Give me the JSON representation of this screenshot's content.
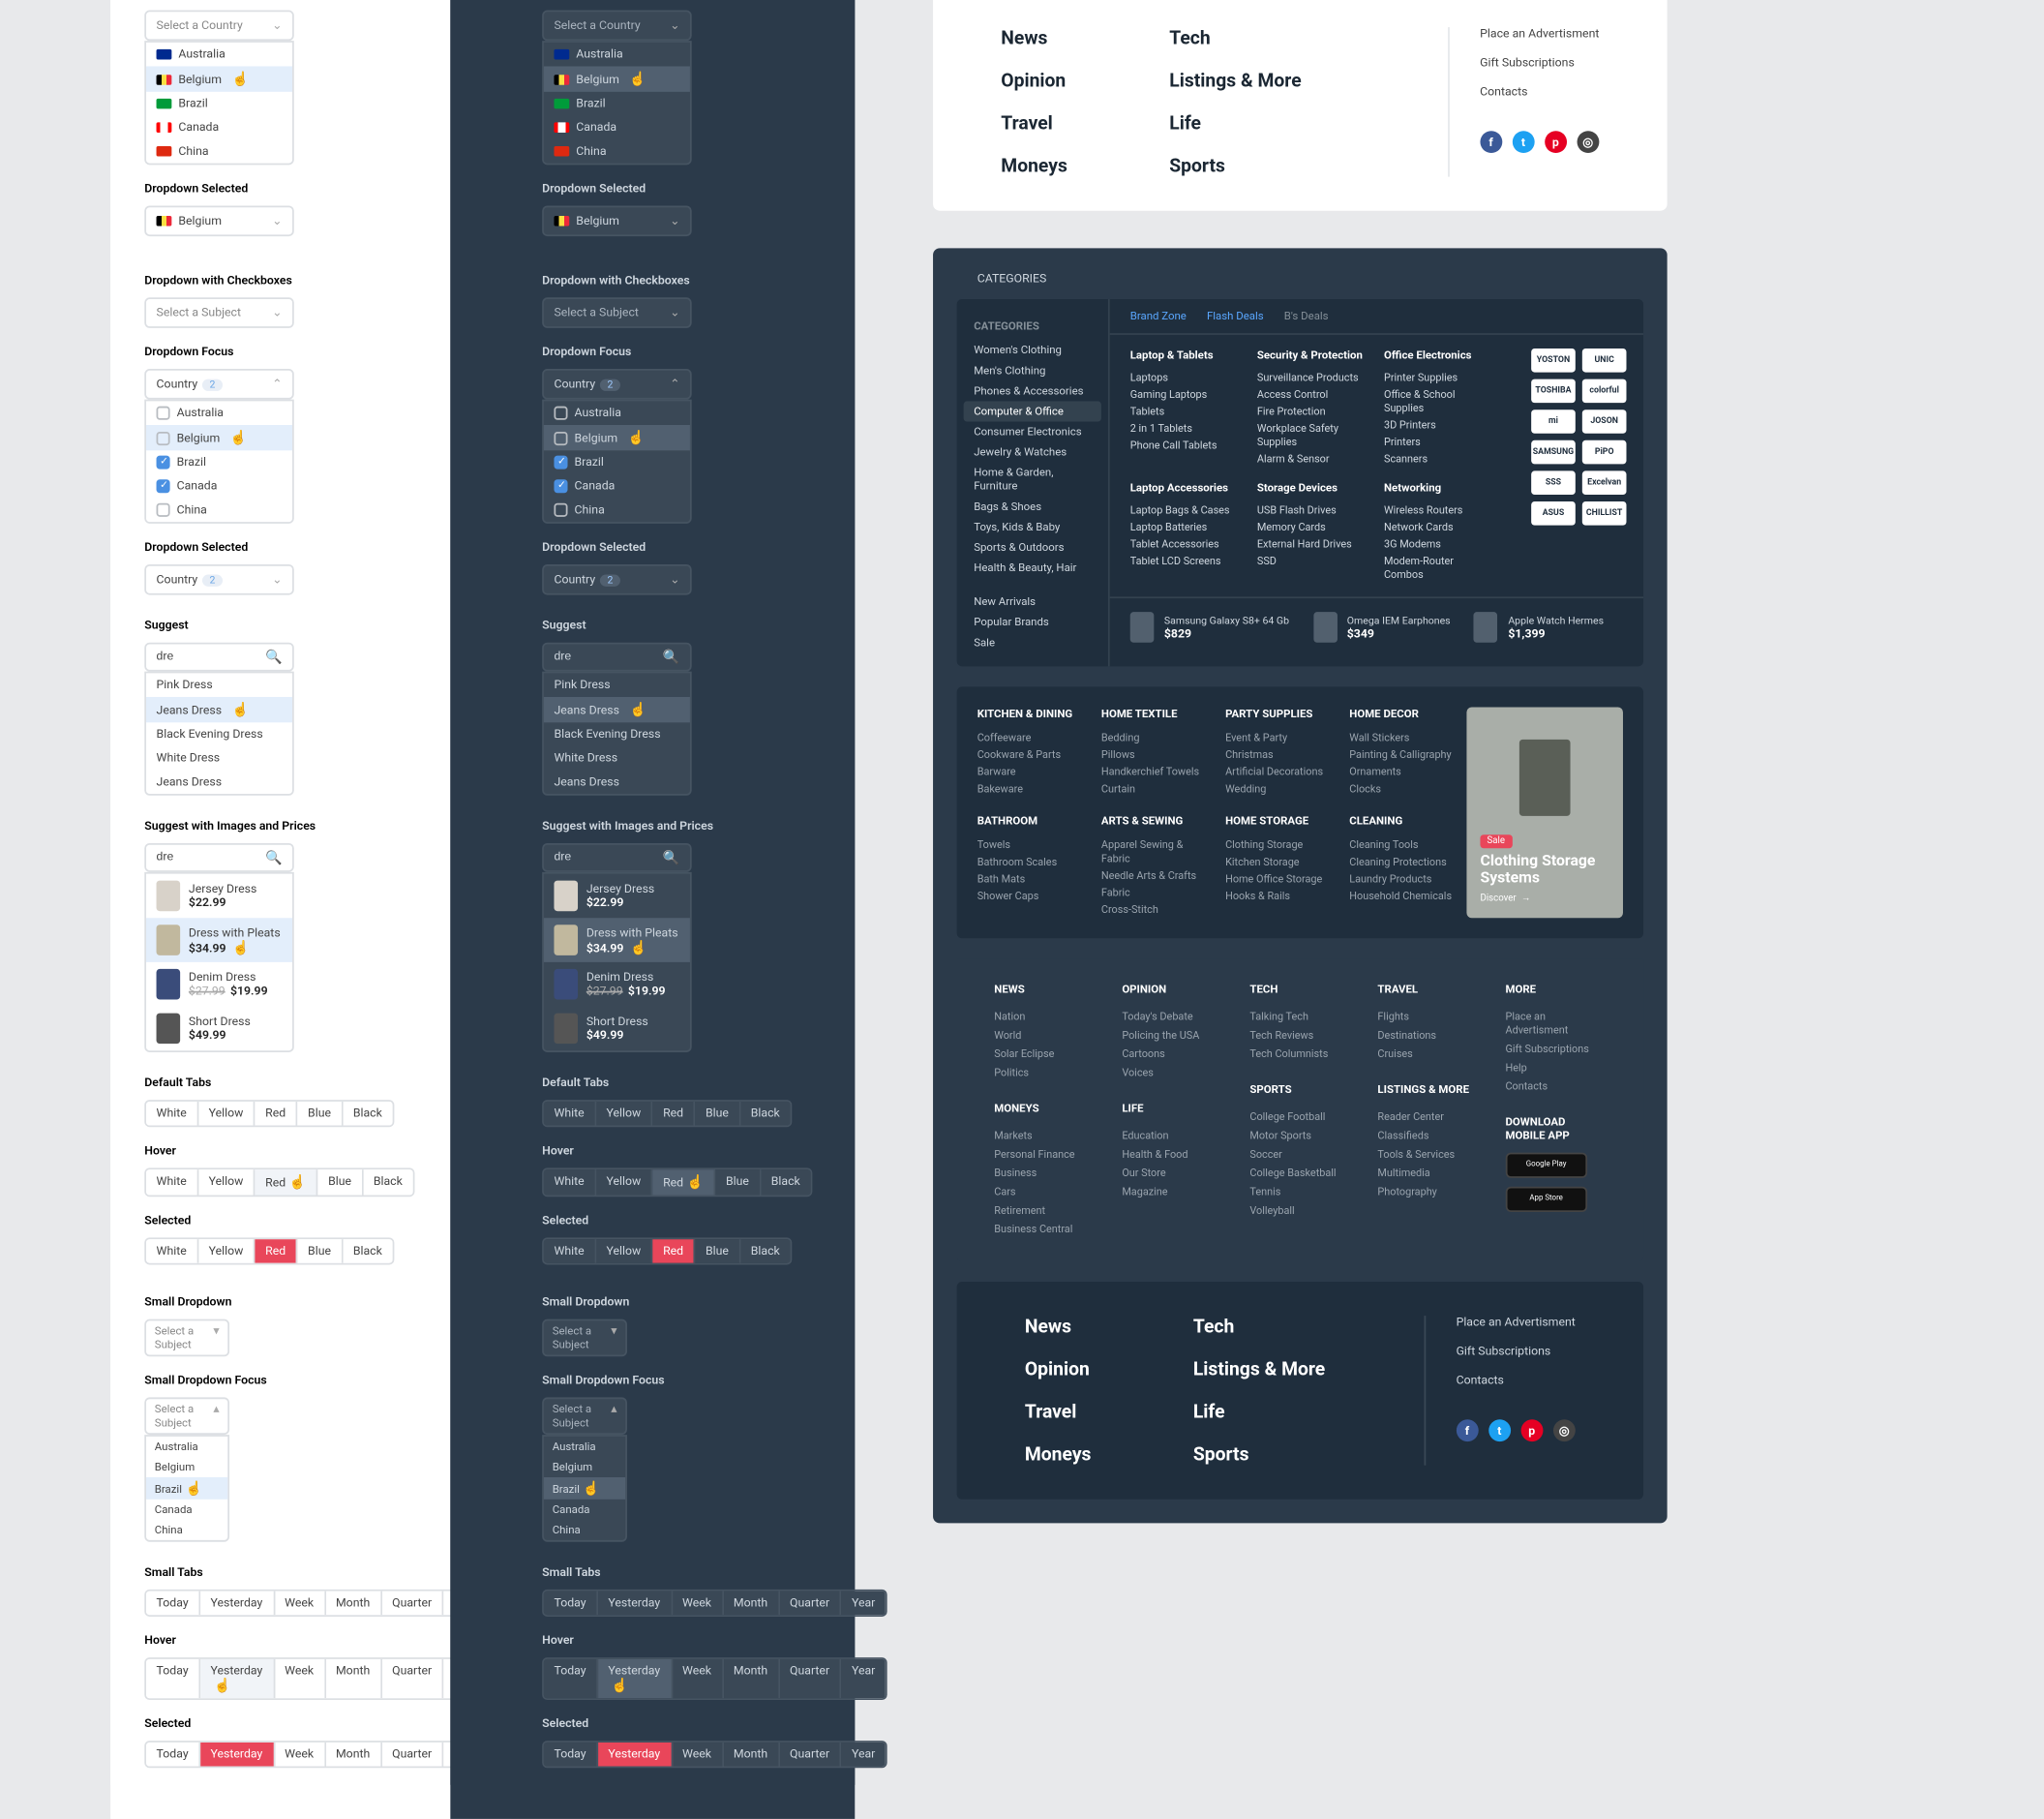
{
  "dd_placeholder": "Select a Country",
  "countries": [
    "Australia",
    "Belgium",
    "Brazil",
    "Canada",
    "China"
  ],
  "section": {
    "dd_selected": "Dropdown Selected",
    "dd_checkboxes": "Dropdown with Checkboxes",
    "dd_focus": "Dropdown Focus",
    "suggest": "Suggest",
    "suggest_img": "Suggest with Images and Prices",
    "default_tabs": "Default Tabs",
    "hover": "Hover",
    "selected": "Selected",
    "small_dd": "Small Dropdown",
    "small_dd_focus": "Small Dropdown Focus",
    "small_tabs": "Small Tabs"
  },
  "subject_placeholder": "Select a Subject",
  "country_label": "Country",
  "count2": "2",
  "suggest_query": "dre",
  "suggest_items": [
    "Pink Dress",
    "Jeans Dress",
    "Black Evening Dress",
    "White Dress",
    "Jeans Dress"
  ],
  "products": [
    {
      "name": "Jersey Dress",
      "price": "$22.99"
    },
    {
      "name": "Dress with Pleats",
      "price": "$34.99"
    },
    {
      "name": "Denim Dress",
      "old": "$27.99",
      "price": "$19.99"
    },
    {
      "name": "Short Dress",
      "price": "$49.99"
    }
  ],
  "colors": [
    "White",
    "Yellow",
    "Red",
    "Blue",
    "Black"
  ],
  "time_tabs": [
    "Today",
    "Yesterday",
    "Week",
    "Month",
    "Quarter",
    "Year"
  ],
  "footer_nav1": [
    "News",
    "Opinion",
    "Travel",
    "Moneys"
  ],
  "footer_nav2": [
    "Tech",
    "Listings & More",
    "Life",
    "Sports"
  ],
  "footer_side": [
    "Place an Advertisment",
    "Gift Subscriptions",
    "Contacts"
  ],
  "categories_title": "Categories",
  "cat_head": "CATEGORIES",
  "cat_side": [
    "Women's Clothing",
    "Men's Clothing",
    "Phones & Accessories",
    "Computer & Office",
    "Consumer Electronics",
    "Jewelry & Watches",
    "Home & Garden, Furniture",
    "Bags & Shoes",
    "Toys, Kids & Baby",
    "Sports & Outdoors",
    "Health & Beauty, Hair"
  ],
  "cat_side2": [
    "New Arrivals",
    "Popular Brands",
    "Sale"
  ],
  "cat_tabs": [
    "Brand Zone",
    "Flash Deals",
    "B's Deals"
  ],
  "cat_groups": [
    {
      "h": "Laptop & Tablets",
      "l": [
        "Laptops",
        "Gaming Laptops",
        "Tablets",
        "2 in 1 Tablets",
        "Phone Call Tablets"
      ]
    },
    {
      "h": "Security & Protection",
      "l": [
        "Surveillance Products",
        "Access Control",
        "Fire Protection",
        "Workplace Safety Supplies",
        "Alarm & Sensor"
      ]
    },
    {
      "h": "Office Electronics",
      "l": [
        "Printer Supplies",
        "Office & School Supplies",
        "3D Printers",
        "Printers",
        "Scanners"
      ]
    }
  ],
  "cat_groups2": [
    {
      "h": "Laptop Accessories",
      "l": [
        "Laptop Bags & Cases",
        "Laptop Batteries",
        "Tablet Accessories",
        "Tablet LCD Screens"
      ]
    },
    {
      "h": "Storage Devices",
      "l": [
        "USB Flash Drives",
        "Memory Cards",
        "External Hard Drives",
        "SSD"
      ]
    },
    {
      "h": "Networking",
      "l": [
        "Wireless Routers",
        "Network Cards",
        "3G Modems",
        "Modem-Router Combos"
      ]
    }
  ],
  "brands": [
    [
      "YOSTON",
      "UNIC"
    ],
    [
      "TOSHIBA",
      "colorful"
    ],
    [
      "mi",
      "JOSON"
    ],
    [
      "SAMSUNG",
      "PiPO"
    ],
    [
      "SSS",
      "Excelvan"
    ],
    [
      "ASUS",
      "CHILLIST"
    ]
  ],
  "promos": [
    {
      "name": "Samsung Galaxy S8+ 64 Gb",
      "price": "$829"
    },
    {
      "name": "Omega IEM Earphones",
      "price": "$349"
    },
    {
      "name": "Apple Watch Hermes",
      "price": "$1,399"
    }
  ],
  "link_groups": [
    {
      "h": "KITCHEN & DINING",
      "l": [
        "Coffeeware",
        "Cookware & Parts",
        "Barware",
        "Bakeware"
      ]
    },
    {
      "h": "HOME TEXTILE",
      "l": [
        "Bedding",
        "Pillows",
        "Handkerchief Towels",
        "Curtain"
      ]
    },
    {
      "h": "PARTY SUPPLIES",
      "l": [
        "Event & Party",
        "Christmas",
        "Artificial Decorations",
        "Wedding"
      ]
    },
    {
      "h": "HOME DECOR",
      "l": [
        "Wall Stickers",
        "Painting & Calligraphy",
        "Ornaments",
        "Clocks"
      ]
    }
  ],
  "link_groups2": [
    {
      "h": "BATHROOM",
      "l": [
        "Towels",
        "Bathroom Scales",
        "Bath Mats",
        "Shower Caps"
      ]
    },
    {
      "h": "ARTS & SEWING",
      "l": [
        "Apparel Sewing & Fabric",
        "Needle Arts & Crafts",
        "Fabric",
        "Cross-Stitch"
      ]
    },
    {
      "h": "HOME STORAGE",
      "l": [
        "Clothing Storage",
        "Kitchen Storage",
        "Home Office Storage",
        "Hooks & Rails"
      ]
    },
    {
      "h": "CLEANING",
      "l": [
        "Cleaning Tools",
        "Cleaning Protections",
        "Laundry Products",
        "Household Chemicals"
      ]
    }
  ],
  "feature": {
    "badge": "Sale",
    "title": "Clothing Storage Systems",
    "disc": "Discover"
  },
  "news_groups": [
    {
      "h": "NEWS",
      "l": [
        "Nation",
        "World",
        "Solar Eclipse",
        "Politics"
      ]
    },
    {
      "h": "OPINION",
      "l": [
        "Today's Debate",
        "Policing the USA",
        "Cartoons",
        "Voices"
      ]
    },
    {
      "h": "TECH",
      "l": [
        "Talking Tech",
        "Tech Reviews",
        "Tech Columnists"
      ]
    },
    {
      "h": "TRAVEL",
      "l": [
        "Flights",
        "Destinations",
        "Cruises"
      ]
    },
    {
      "h": "MORE",
      "l": [
        "Place an Advertisment",
        "Gift Subscriptions",
        "Help",
        "Contacts"
      ]
    }
  ],
  "news_groups2": [
    {
      "h": "MONEYS",
      "l": [
        "Markets",
        "Personal Finance",
        "Business",
        "Cars",
        "Retirement",
        "Business Central"
      ]
    },
    {
      "h": "LIFE",
      "l": [
        "Education",
        "Health & Food",
        "Our Store",
        "Magazine"
      ]
    },
    {
      "h": "SPORTS",
      "l": [
        "College Football",
        "Motor Sports",
        "Soccer",
        "College Basketball",
        "Tennis",
        "Volleyball"
      ]
    },
    {
      "h": "LISTINGS & MORE",
      "l": [
        "Reader Center",
        "Classifieds",
        "Tools & Services",
        "Multimedia",
        "Photography"
      ]
    },
    {
      "h": "DOWNLOAD MOBILE APP",
      "apps": [
        "Google Play",
        "App Store"
      ]
    }
  ]
}
